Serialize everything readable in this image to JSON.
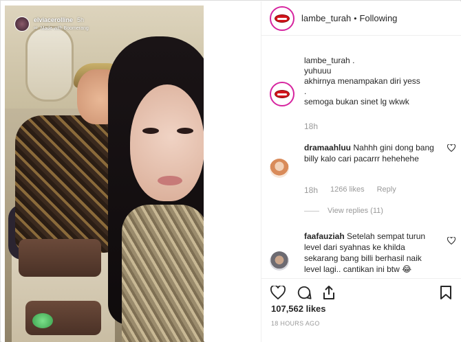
{
  "story": {
    "username": "elviacerolline",
    "time": "5h",
    "boomerang_label": "Made with Boomerang"
  },
  "header": {
    "username": "lambe_turah",
    "separator": "•",
    "follow_status": "Following"
  },
  "caption": {
    "username": "lambe_turah",
    "lines": [
      ".",
      "yuhuuu",
      "akhirnya menampakan diri yess",
      ".",
      "semoga bukan sinet lg wkwk"
    ],
    "time": "18h"
  },
  "comments": [
    {
      "username": "dramaahluu",
      "text": "Nahhh gini dong bang billy kalo cari pacarrr hehehehe",
      "time": "18h",
      "likes": "1266 likes",
      "reply_label": "Reply",
      "view_replies": "View replies (11)"
    },
    {
      "username": "faafauziah",
      "text": "Setelah sempat turun level dari syahnas ke khilda sekarang bang billi berhasil naik level lagi.. cantikan ini btw 😂"
    }
  ],
  "actions": {
    "likes_count": "107,562 likes",
    "time_ago": "18 HOURS AGO"
  },
  "icons": {
    "heart": "heart-icon",
    "comment": "comment-icon",
    "share": "share-icon",
    "bookmark": "bookmark-icon",
    "boomerang": "infinity-icon"
  },
  "colors": {
    "brand_lips": "#d2141a",
    "muted_text": "#999999",
    "border": "#efefef"
  }
}
